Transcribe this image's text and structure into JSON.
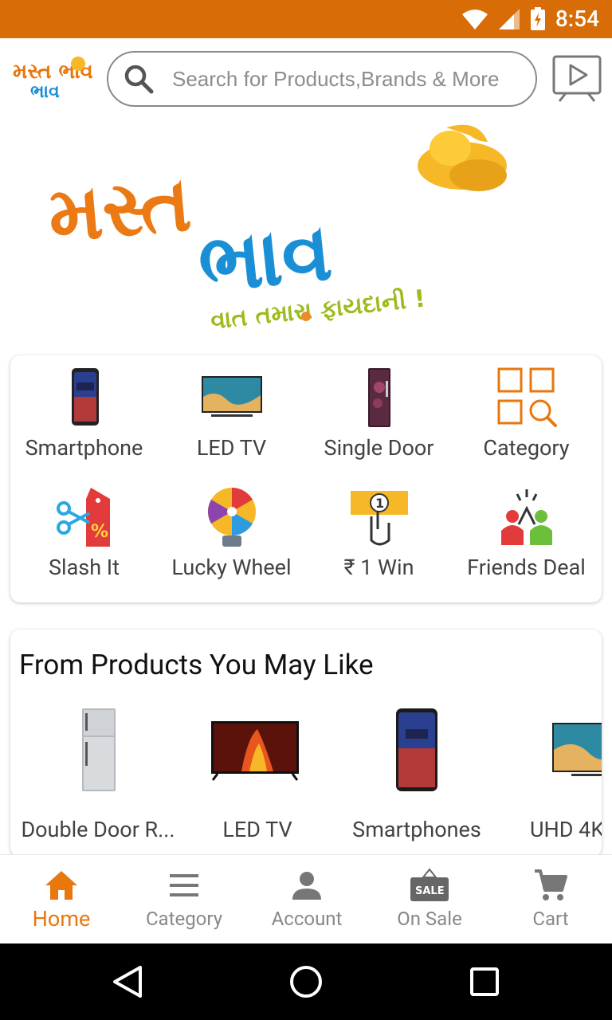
{
  "status_bar": {
    "time": "8:54"
  },
  "header": {
    "logo_text": "મસ્ત ભાવ",
    "search_placeholder": "Search for Products,Brands & More"
  },
  "banner": {
    "line1": "મસ્ત",
    "line2": "ભાવ",
    "tagline": "વાત તમારા ફાયદાની !"
  },
  "quick_links": [
    {
      "label": "Smartphone",
      "icon": "smartphone-icon"
    },
    {
      "label": "LED TV",
      "icon": "led-tv-icon"
    },
    {
      "label": "Single Door",
      "icon": "single-door-fridge-icon"
    },
    {
      "label": "Category",
      "icon": "category-grid-icon"
    },
    {
      "label": "Slash It",
      "icon": "slash-it-icon"
    },
    {
      "label": "Lucky Wheel",
      "icon": "lucky-wheel-icon"
    },
    {
      "label": "₹ 1 Win",
      "icon": "rupee-win-icon"
    },
    {
      "label": "Friends Deal",
      "icon": "friends-deal-icon"
    }
  ],
  "products_section": {
    "title": "From Products You May Like",
    "items": [
      {
        "label": "Double Door R...",
        "icon": "double-door-fridge-icon"
      },
      {
        "label": "LED TV",
        "icon": "led-tv-icon"
      },
      {
        "label": "Smartphones",
        "icon": "smartphone-icon"
      },
      {
        "label": "UHD 4K",
        "icon": "uhd-tv-icon"
      }
    ]
  },
  "bottom_nav": [
    {
      "label": "Home",
      "icon": "home-icon",
      "active": true
    },
    {
      "label": "Category",
      "icon": "menu-icon",
      "active": false
    },
    {
      "label": "Account",
      "icon": "person-icon",
      "active": false
    },
    {
      "label": "On Sale",
      "icon": "sale-tag-icon",
      "active": false,
      "badge": "SALE"
    },
    {
      "label": "Cart",
      "icon": "cart-icon",
      "active": false
    }
  ],
  "colors": {
    "brand_orange": "#d86c06",
    "brand_blue": "#1a8fd6",
    "accent_active": "#e8770e",
    "tagline_green": "#9cbb1c"
  }
}
